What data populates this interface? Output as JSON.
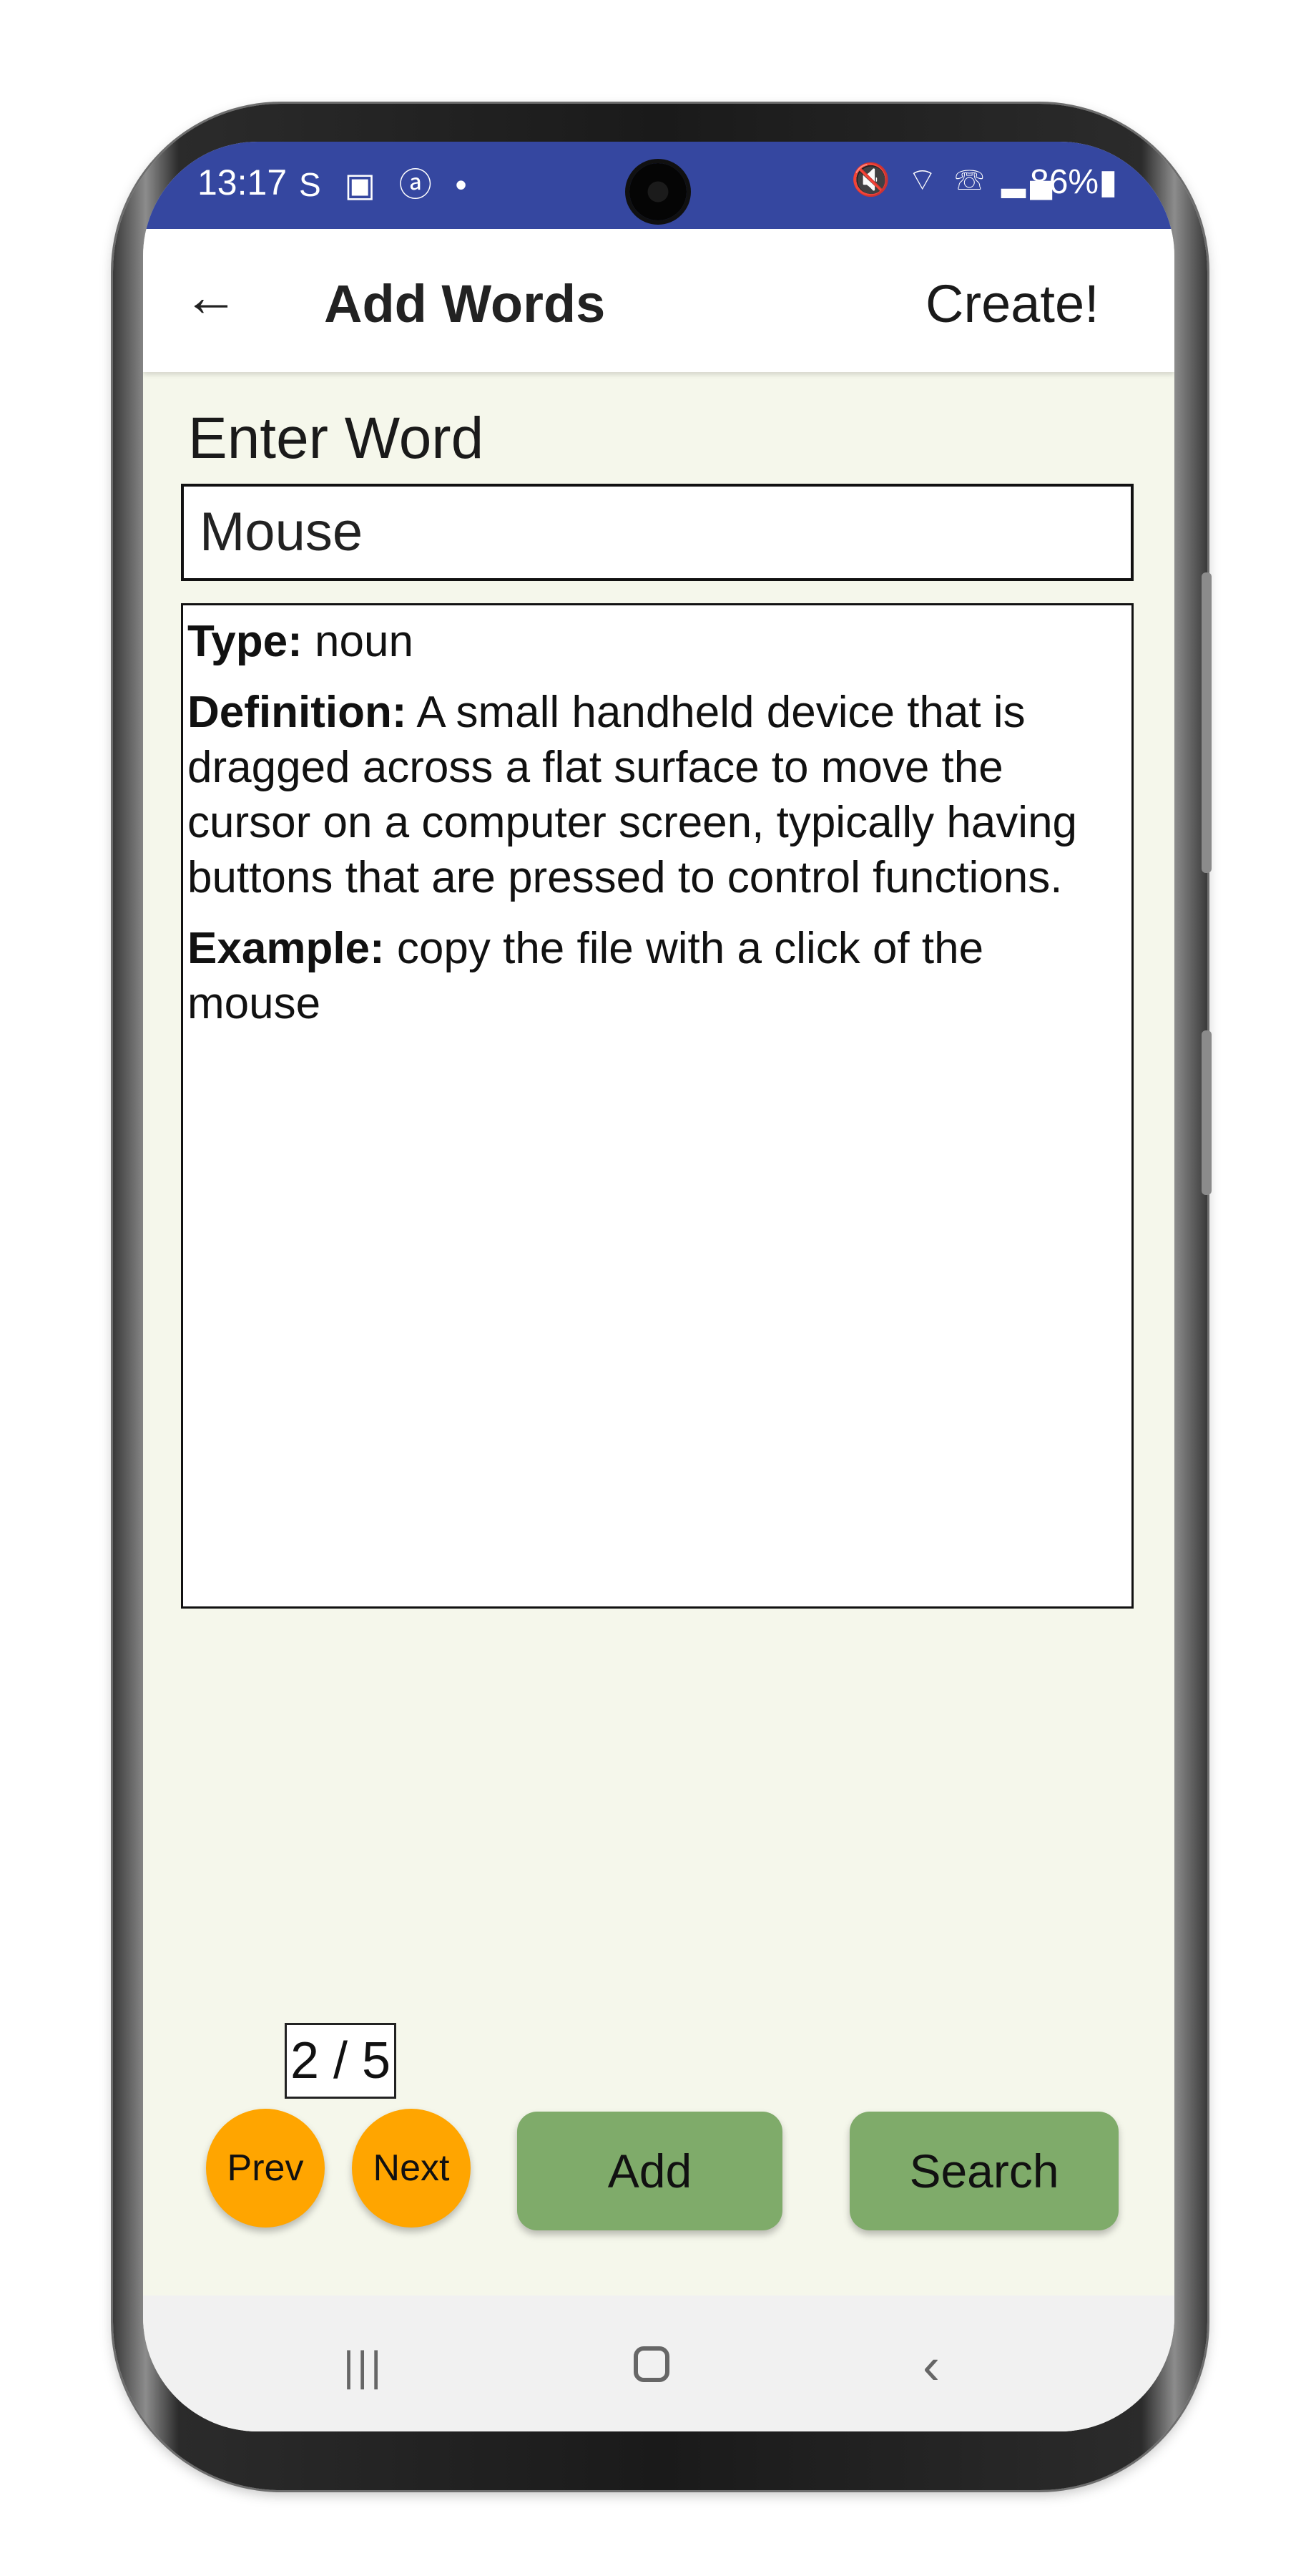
{
  "status_bar": {
    "time": "13:17",
    "notification_icons": "S ▣ ⓐ •",
    "system_icons": "🔇 ⌔ ☏ ▂▄",
    "battery": "86%▮",
    "color": "#3547a0"
  },
  "app_bar": {
    "back_icon": "←",
    "title": "Add Words",
    "create_label": "Create!"
  },
  "form": {
    "enter_label": "Enter Word",
    "word_value": "Mouse"
  },
  "definition": {
    "type_label": "Type:",
    "type_value": "noun",
    "definition_label": "Definition:",
    "definition_value": "A small handheld device that is dragged across a flat surface to move the cursor on a computer screen, typically having buttons that are pressed to control functions.",
    "example_label": "Example:",
    "example_value": "copy the file with a click of the mouse"
  },
  "pager": {
    "counter": "2 / 5",
    "prev_label": "Prev",
    "next_label": "Next"
  },
  "actions": {
    "add_label": "Add",
    "search_label": "Search"
  },
  "nav": {
    "recent_icon": "|||",
    "back_icon": "‹"
  },
  "colors": {
    "accent_orange": "#ffa500",
    "button_green": "#7fab6a",
    "background": "#f5f7eb"
  }
}
